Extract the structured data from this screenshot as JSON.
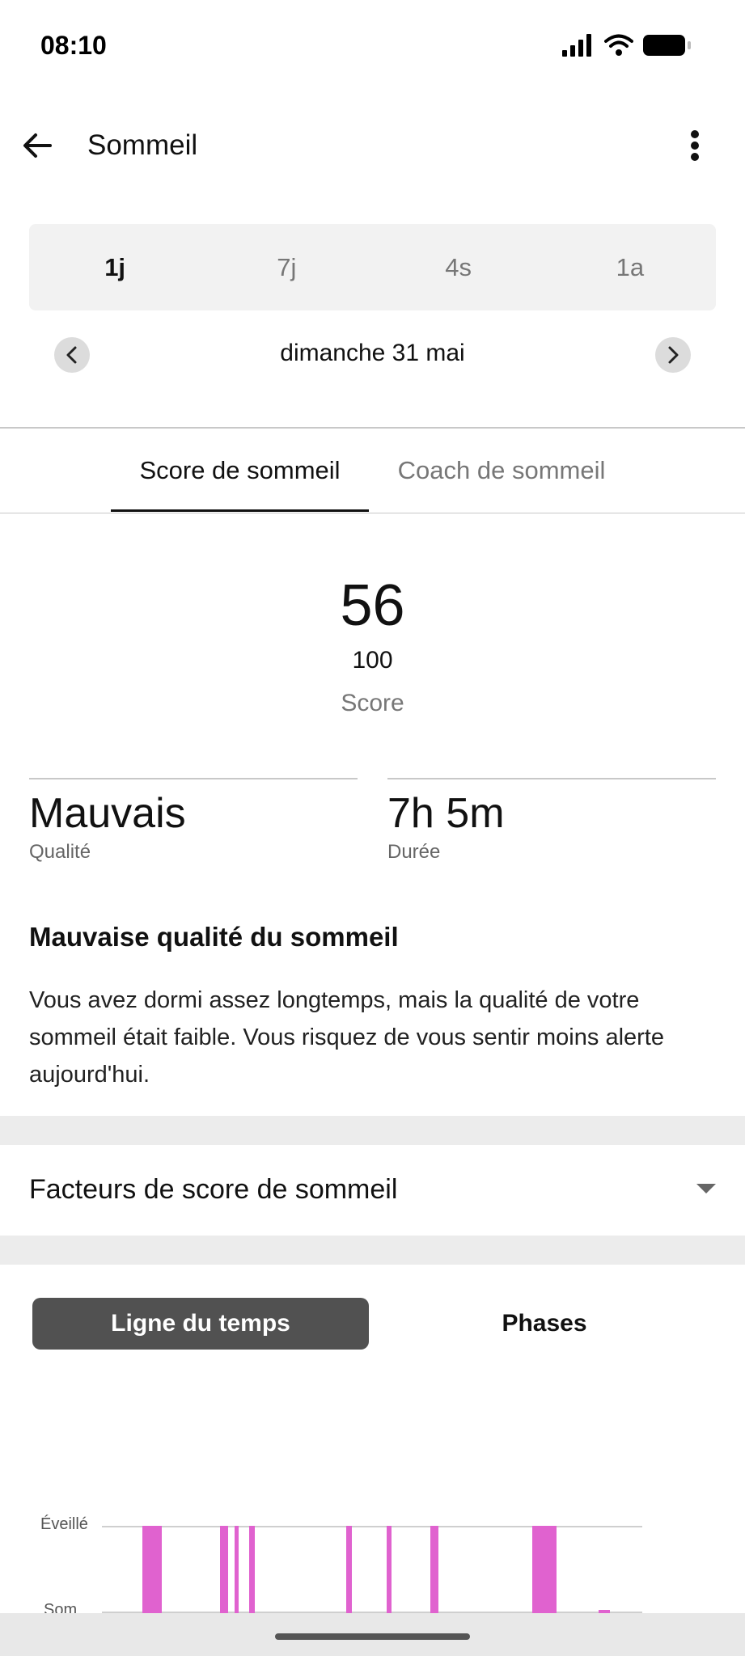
{
  "status": {
    "time": "08:10"
  },
  "app_bar": {
    "title": "Sommeil"
  },
  "range": {
    "options": [
      "1j",
      "7j",
      "4s",
      "1a"
    ],
    "selected": "1j"
  },
  "date": {
    "label": "dimanche 31 mai"
  },
  "tabs": [
    {
      "label": "Score de sommeil",
      "active": true
    },
    {
      "label": "Coach de sommeil",
      "active": false
    }
  ],
  "score": {
    "value": "56",
    "max": "100",
    "label": "Score"
  },
  "metrics": [
    {
      "value": "Mauvais",
      "label": "Qualité"
    },
    {
      "value": "7h 5m",
      "label": "Durée"
    }
  ],
  "insight": {
    "title": "Mauvaise qualité du sommeil",
    "body": "Vous avez dormi assez longtemps, mais la qualité de votre sommeil était faible. Vous risquez de vous sentir moins alerte aujourd'hui."
  },
  "factors": {
    "label": "Facteurs de score de sommeil"
  },
  "view_toggle": {
    "active": "Ligne du temps",
    "inactive": "Phases"
  },
  "timeline": {
    "levels": [
      "Éveillé",
      "Som"
    ],
    "awake_color": "#e062cf"
  },
  "colors": {
    "accent": "#515151",
    "awake": "#e062cf"
  }
}
